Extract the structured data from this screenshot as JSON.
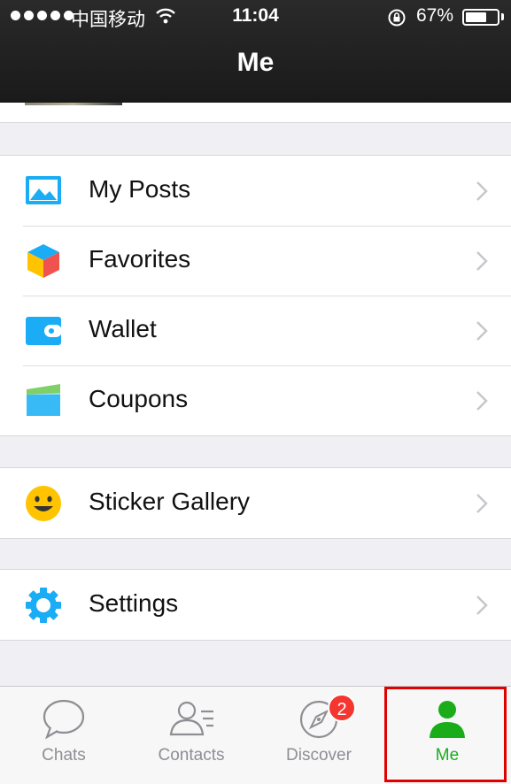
{
  "status_bar": {
    "carrier": "中国移动",
    "time": "11:04",
    "battery_text": "67%",
    "battery_level": 0.67
  },
  "header": {
    "title": "Me"
  },
  "groups": [
    {
      "items": [
        {
          "label": "My Posts",
          "icon": "photo-icon"
        },
        {
          "label": "Favorites",
          "icon": "favorites-cube-icon"
        },
        {
          "label": "Wallet",
          "icon": "wallet-icon"
        },
        {
          "label": "Coupons",
          "icon": "coupon-icon"
        }
      ]
    },
    {
      "items": [
        {
          "label": "Sticker Gallery",
          "icon": "smiley-icon"
        }
      ]
    },
    {
      "items": [
        {
          "label": "Settings",
          "icon": "gear-icon"
        }
      ]
    }
  ],
  "tabbar": {
    "tabs": [
      {
        "label": "Chats",
        "icon": "chat-bubble-icon"
      },
      {
        "label": "Contacts",
        "icon": "contacts-icon"
      },
      {
        "label": "Discover",
        "icon": "compass-icon",
        "badge": "2"
      },
      {
        "label": "Me",
        "icon": "person-icon",
        "active": true
      }
    ]
  },
  "colors": {
    "active_tab": "#1aad19",
    "badge": "#f43530",
    "highlight": "#e00000",
    "icon_blue": "#1aadf5"
  }
}
